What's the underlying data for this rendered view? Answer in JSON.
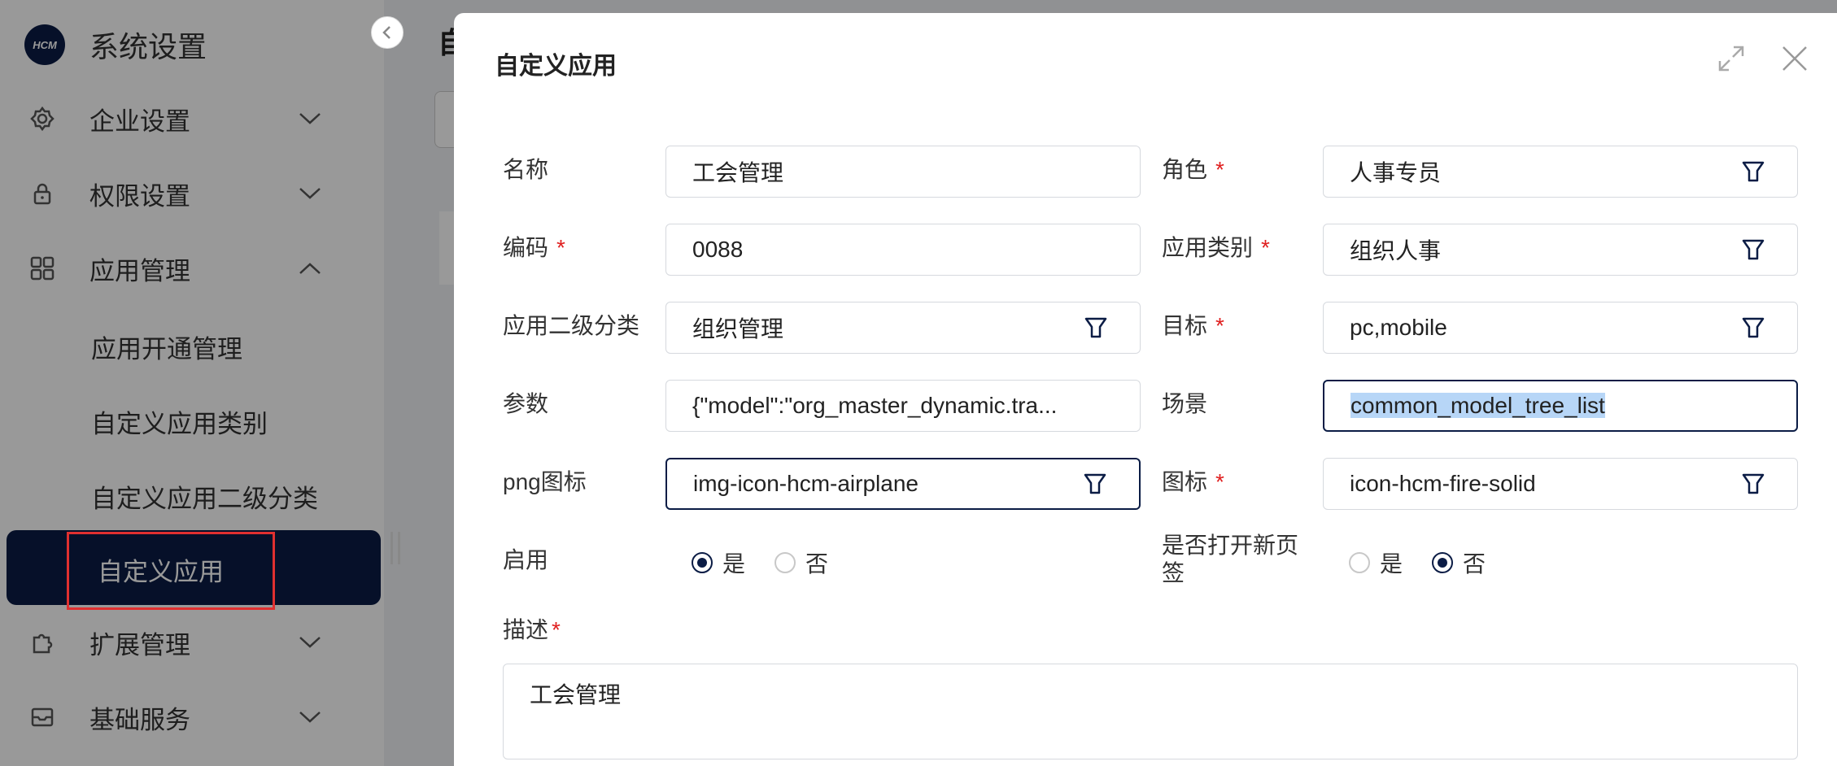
{
  "sidebar": {
    "logo_text": "HCM",
    "app_title": "系统设置",
    "menu": [
      {
        "label": "企业设置",
        "icon": "gear-icon"
      },
      {
        "label": "权限设置",
        "icon": "lock-icon"
      },
      {
        "label": "应用管理",
        "icon": "grid-icon"
      },
      {
        "label": "扩展管理",
        "icon": "puzzle-icon"
      },
      {
        "label": "基础服务",
        "icon": "archive-icon"
      }
    ],
    "submenu": [
      "应用开通管理",
      "自定义应用类别",
      "自定义应用二级分类"
    ],
    "active": "自定义应用"
  },
  "background": {
    "page_title_partial": "自"
  },
  "modal": {
    "title": "自定义应用",
    "fields": {
      "name": {
        "label": "名称",
        "value": "工会管理"
      },
      "role": {
        "label": "角色",
        "value": "人事专员"
      },
      "code": {
        "label": "编码",
        "value": "0088"
      },
      "app_category": {
        "label": "应用类别",
        "value": "组织人事"
      },
      "sub_category": {
        "label": "应用二级分类",
        "value": "组织管理"
      },
      "target": {
        "label": "目标",
        "value": "pc,mobile"
      },
      "params": {
        "label": "参数",
        "value": "{\"model\":\"org_master_dynamic.tra..."
      },
      "scene": {
        "label": "场景",
        "value": "common_model_tree_list"
      },
      "png_icon": {
        "label": "png图标",
        "value": "img-icon-hcm-airplane"
      },
      "icon": {
        "label": "图标",
        "value": "icon-hcm-fire-solid"
      }
    },
    "enable": {
      "label": "启用",
      "yes": "是",
      "no": "否",
      "selected": "是"
    },
    "new_tab": {
      "label_line1": "是否打开新页",
      "label_line2": "签",
      "yes": "是",
      "no": "否",
      "selected": "否"
    },
    "description": {
      "label": "描述",
      "value": "工会管理"
    },
    "required_mark": "*"
  },
  "colors": {
    "primary": "#0b1c45",
    "required": "#e02020",
    "highlight": "#b7d6f7"
  }
}
